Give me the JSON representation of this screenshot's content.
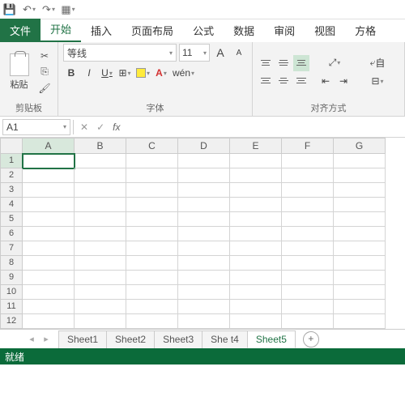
{
  "qat": {
    "save": "💾"
  },
  "tabs": {
    "file": "文件",
    "home": "开始",
    "insert": "插入",
    "layout": "页面布局",
    "formula": "公式",
    "data": "数据",
    "review": "审阅",
    "view": "视图",
    "square": "方格"
  },
  "ribbon": {
    "clipboard": {
      "paste": "粘贴",
      "label": "剪贴板"
    },
    "font": {
      "name": "等线",
      "size": "11",
      "bold": "B",
      "italic": "I",
      "underline": "U",
      "wen": "wén",
      "label": "字体",
      "grow": "A",
      "shrink": "A"
    },
    "align": {
      "label": "对齐方式",
      "auto": "自"
    }
  },
  "namebox": {
    "ref": "A1",
    "fx": "fx"
  },
  "columns": [
    "A",
    "B",
    "C",
    "D",
    "E",
    "F",
    "G"
  ],
  "rows": [
    "1",
    "2",
    "3",
    "4",
    "5",
    "6",
    "7",
    "8",
    "9",
    "10",
    "11",
    "12"
  ],
  "sheets": [
    "Sheet1",
    "Sheet2",
    "Sheet3",
    "Sheet4",
    "Sheet5"
  ],
  "active_sheet": 4,
  "status": "就绪",
  "plus": "+",
  "cursor_text": "She  t4"
}
